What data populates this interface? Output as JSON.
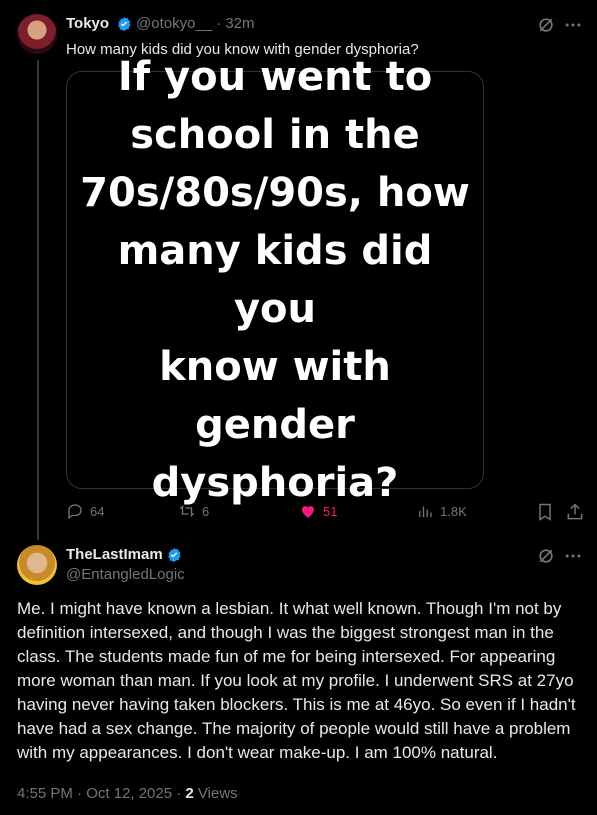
{
  "tweet": {
    "author_name": "Tokyo",
    "handle": "@otokyo__",
    "time": "· 32m",
    "text": "How many kids did you know with gender dysphoria?",
    "image_text": "If you went to\nschool in the\n70s/80s/90s, how\nmany kids did you\nknow with gender\ndysphoria?",
    "replies": "64",
    "reposts": "6",
    "likes": "51",
    "views": "1.8K",
    "like_color": "#f91880"
  },
  "reply": {
    "author_name": "TheLastImam",
    "handle": "@EntangledLogic",
    "text": "Me. I might have known a lesbian. It what well known. Though I'm not by definition intersexed, and though I was the biggest strongest man in the class. The students made fun of me for being intersexed. For appearing more woman than man. If you look at my profile. I underwent SRS at 27yo having never having taken blockers. This is me at 46yo. So even if I hadn't have had a sex change. The majority of people would still have a problem with my appearances. I don't wear make-up. I am 100% natural.",
    "timestamp": "4:55 PM · Oct 12, 2025 · ",
    "views_count": "2",
    "views_label": " Views"
  },
  "colors": {
    "verified": "#1d9bf0",
    "muted": "#71767b",
    "background": "#000000"
  },
  "icons": [
    "grok-icon",
    "more-icon",
    "reply-icon",
    "repost-icon",
    "heart-icon",
    "views-icon",
    "bookmark-icon",
    "share-icon",
    "verified-icon"
  ]
}
